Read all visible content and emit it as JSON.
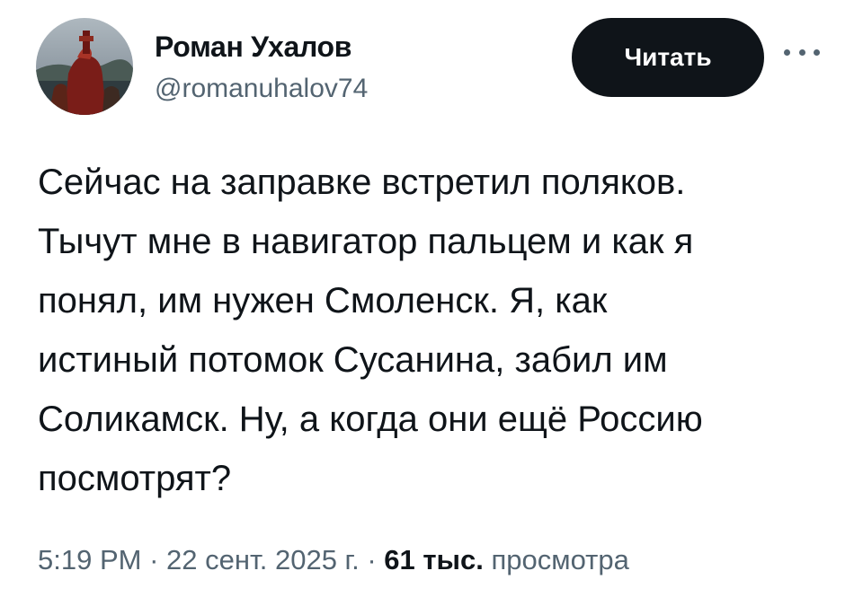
{
  "author": {
    "name": "Роман Ухалов",
    "handle": "@romanuhalov74",
    "avatar_icon": "profile-photo"
  },
  "follow_button": {
    "label": "Читать"
  },
  "more_menu": {
    "icon": "more-horizontal-icon"
  },
  "tweet": {
    "lines": [
      "Сейчас на заправке встретил поляков.",
      "Тычут мне в навигатор пальцем и как я",
      "понял, им нужен Смоленск. Я, как",
      "истиный потомок Сусанина, забил им",
      "Соликамск. Ну, а когда они ещё Россию",
      "посмотрят?"
    ]
  },
  "meta": {
    "time": "5:19 PM",
    "separator": "·",
    "date": "22 сент. 2025 г.",
    "views_count": "61 тыс.",
    "views_label": "просмотра"
  },
  "colors": {
    "text_primary": "#0f1419",
    "text_secondary": "#536471",
    "button_bg": "#0f1419",
    "button_text": "#ffffff",
    "background": "#ffffff"
  }
}
